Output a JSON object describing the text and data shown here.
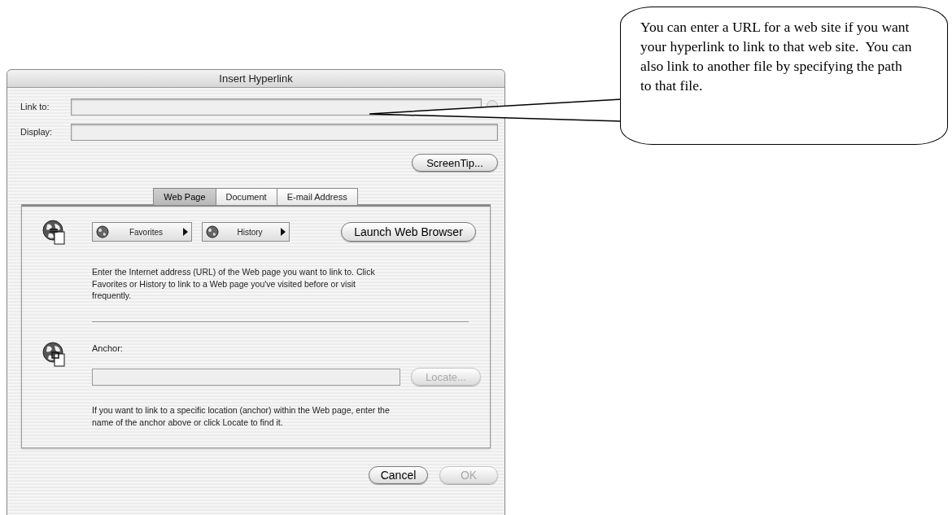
{
  "callout": {
    "text": "You can enter a URL for a web site if you want your hyperlink to link to that web site.  You can also link to another file by specifying the path to that file."
  },
  "window": {
    "title": "Insert Hyperlink"
  },
  "fields": [
    {
      "label": "Link to:",
      "has_menu": true
    },
    {
      "label": "Display:",
      "has_menu": false
    }
  ],
  "screentip_button": {
    "label": "ScreenTip...",
    "disabled": false
  },
  "tabs": [
    {
      "label": "Web Page",
      "selected": true
    },
    {
      "label": "Document",
      "selected": false
    },
    {
      "label": "E-mail Address",
      "selected": false
    }
  ],
  "web_page": {
    "menus": [
      {
        "label": "Favorites"
      },
      {
        "label": "History"
      }
    ],
    "launch_button": {
      "label": "Launch Web Browser",
      "disabled": false
    },
    "description": "Enter the Internet address (URL) of the Web page you want to link to. Click Favorites or History to link to a Web page you've visited before or visit frequently.",
    "anchor_label": "Anchor:",
    "locate_button": {
      "label": "Locate...",
      "disabled": true
    },
    "anchor_help": "If you want to link to a specific location (anchor) within the Web page, enter the name of the anchor above or click Locate to find it."
  },
  "buttons": [
    {
      "label": "Cancel",
      "disabled": false
    },
    {
      "label": "OK",
      "disabled": true
    }
  ]
}
